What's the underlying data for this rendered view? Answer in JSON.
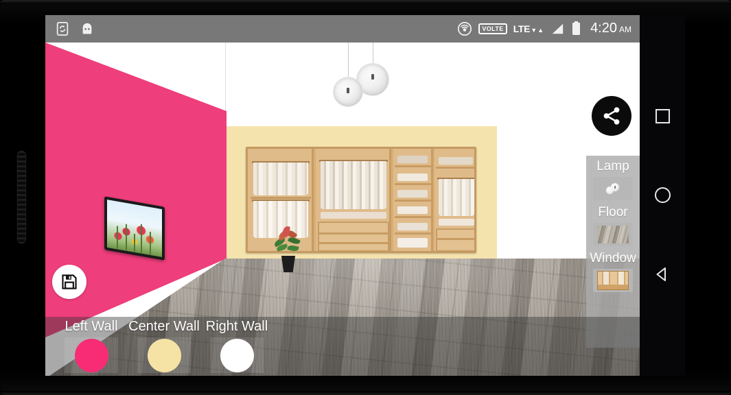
{
  "status_bar": {
    "left_icons": [
      {
        "name": "phone-sync-icon",
        "label": "phone-sync"
      },
      {
        "name": "android-head-icon",
        "label": "android"
      }
    ],
    "right_icons": [
      {
        "name": "hotspot-icon",
        "label": "hotspot"
      },
      {
        "name": "volte-badge",
        "label": "VOLTE"
      },
      {
        "name": "lte-icon",
        "label": "LTE"
      },
      {
        "name": "signal-icon",
        "label": "signal"
      },
      {
        "name": "battery-icon",
        "label": "battery"
      }
    ],
    "lte_label": "LTE",
    "volte_label": "VOLTE",
    "lte_down_arrow": "▼",
    "lte_up_arrow": "▲",
    "time": "4:20",
    "am_pm": "AM"
  },
  "scene": {
    "left_wall_color": "#EE3E7B",
    "center_wall_color": "#F5E3AE",
    "right_wall_color": "#FFFFFF",
    "ceiling_color": "#FFFFFF",
    "floor_label": "wood-plank-floor",
    "objects": [
      {
        "name": "tv-on-left-wall",
        "label": "TV with tulips image"
      },
      {
        "name": "wardrobe-on-center-wall",
        "label": "Wardrobe closet"
      },
      {
        "name": "potted-plant",
        "label": "Potted plant"
      },
      {
        "name": "pendant-lamps",
        "label": "Two pendant globe lamps"
      }
    ]
  },
  "buttons": {
    "share_icon": "share-icon",
    "save_icon": "save-floppy-icon"
  },
  "side_panel": {
    "items": [
      {
        "label": "Lamp",
        "thumb": "lamp-thumbnail"
      },
      {
        "label": "Floor",
        "thumb": "floor-thumbnail"
      },
      {
        "label": "Window",
        "thumb": "window-thumbnail"
      }
    ]
  },
  "wall_bar": {
    "options": [
      {
        "label": "Left Wall",
        "color": "#F72C74"
      },
      {
        "label": "Center Wall",
        "color": "#F5E3A5"
      },
      {
        "label": "Right Wall",
        "color": "#FFFFFF"
      }
    ]
  },
  "nav_bar": {
    "buttons": [
      {
        "name": "recents-button",
        "icon": "square-icon"
      },
      {
        "name": "home-button",
        "icon": "circle-icon"
      },
      {
        "name": "back-button",
        "icon": "triangle-left-icon"
      }
    ]
  }
}
